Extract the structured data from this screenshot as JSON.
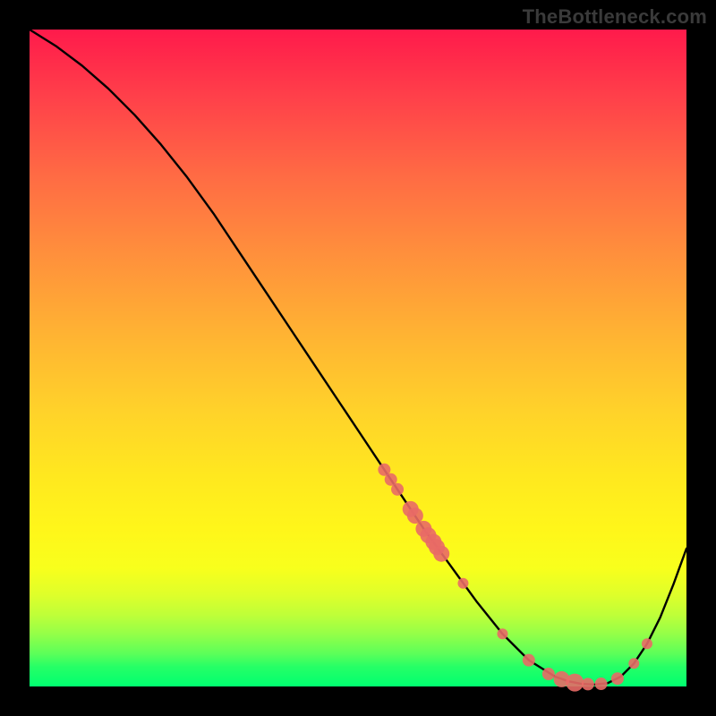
{
  "watermark": "TheBottleneck.com",
  "colors": {
    "frame": "#000000",
    "gradient_top": "#ff1a4b",
    "gradient_bottom": "#00ff70",
    "curve": "#000000",
    "marker": "#e96a66"
  },
  "chart_data": {
    "type": "line",
    "title": "",
    "xlabel": "",
    "ylabel": "",
    "xlim": [
      0,
      100
    ],
    "ylim": [
      0,
      100
    ],
    "curve": {
      "x": [
        0,
        4,
        8,
        12,
        16,
        20,
        24,
        28,
        32,
        36,
        40,
        44,
        48,
        52,
        56,
        60,
        64,
        68,
        72,
        76,
        80,
        82,
        84,
        86,
        88,
        90,
        92,
        94,
        96,
        98,
        100
      ],
      "y": [
        100,
        97.5,
        94.5,
        91.0,
        87.0,
        82.5,
        77.5,
        72.0,
        66.0,
        60.0,
        54.0,
        48.0,
        42.0,
        36.0,
        30.0,
        24.0,
        18.5,
        13.0,
        8.0,
        4.0,
        1.5,
        0.8,
        0.4,
        0.3,
        0.5,
        1.5,
        3.5,
        6.5,
        10.5,
        15.5,
        21.0
      ]
    },
    "markers": {
      "x": [
        54,
        55,
        56,
        58,
        58.7,
        60,
        60.7,
        61.5,
        62,
        62.7,
        66,
        72,
        76,
        79,
        81,
        83,
        85,
        87,
        89.5,
        92,
        94
      ],
      "y": [
        33.0,
        31.5,
        30.0,
        27.0,
        26.0,
        24.0,
        23.0,
        22.0,
        21.2,
        20.2,
        15.7,
        8.0,
        4.0,
        1.9,
        1.1,
        0.6,
        0.35,
        0.4,
        1.2,
        3.5,
        6.5
      ],
      "r": [
        7,
        7,
        7,
        9,
        9,
        9,
        9,
        9,
        9,
        9,
        6,
        6,
        7,
        7,
        9,
        10,
        7,
        7,
        7,
        6,
        6
      ]
    }
  }
}
